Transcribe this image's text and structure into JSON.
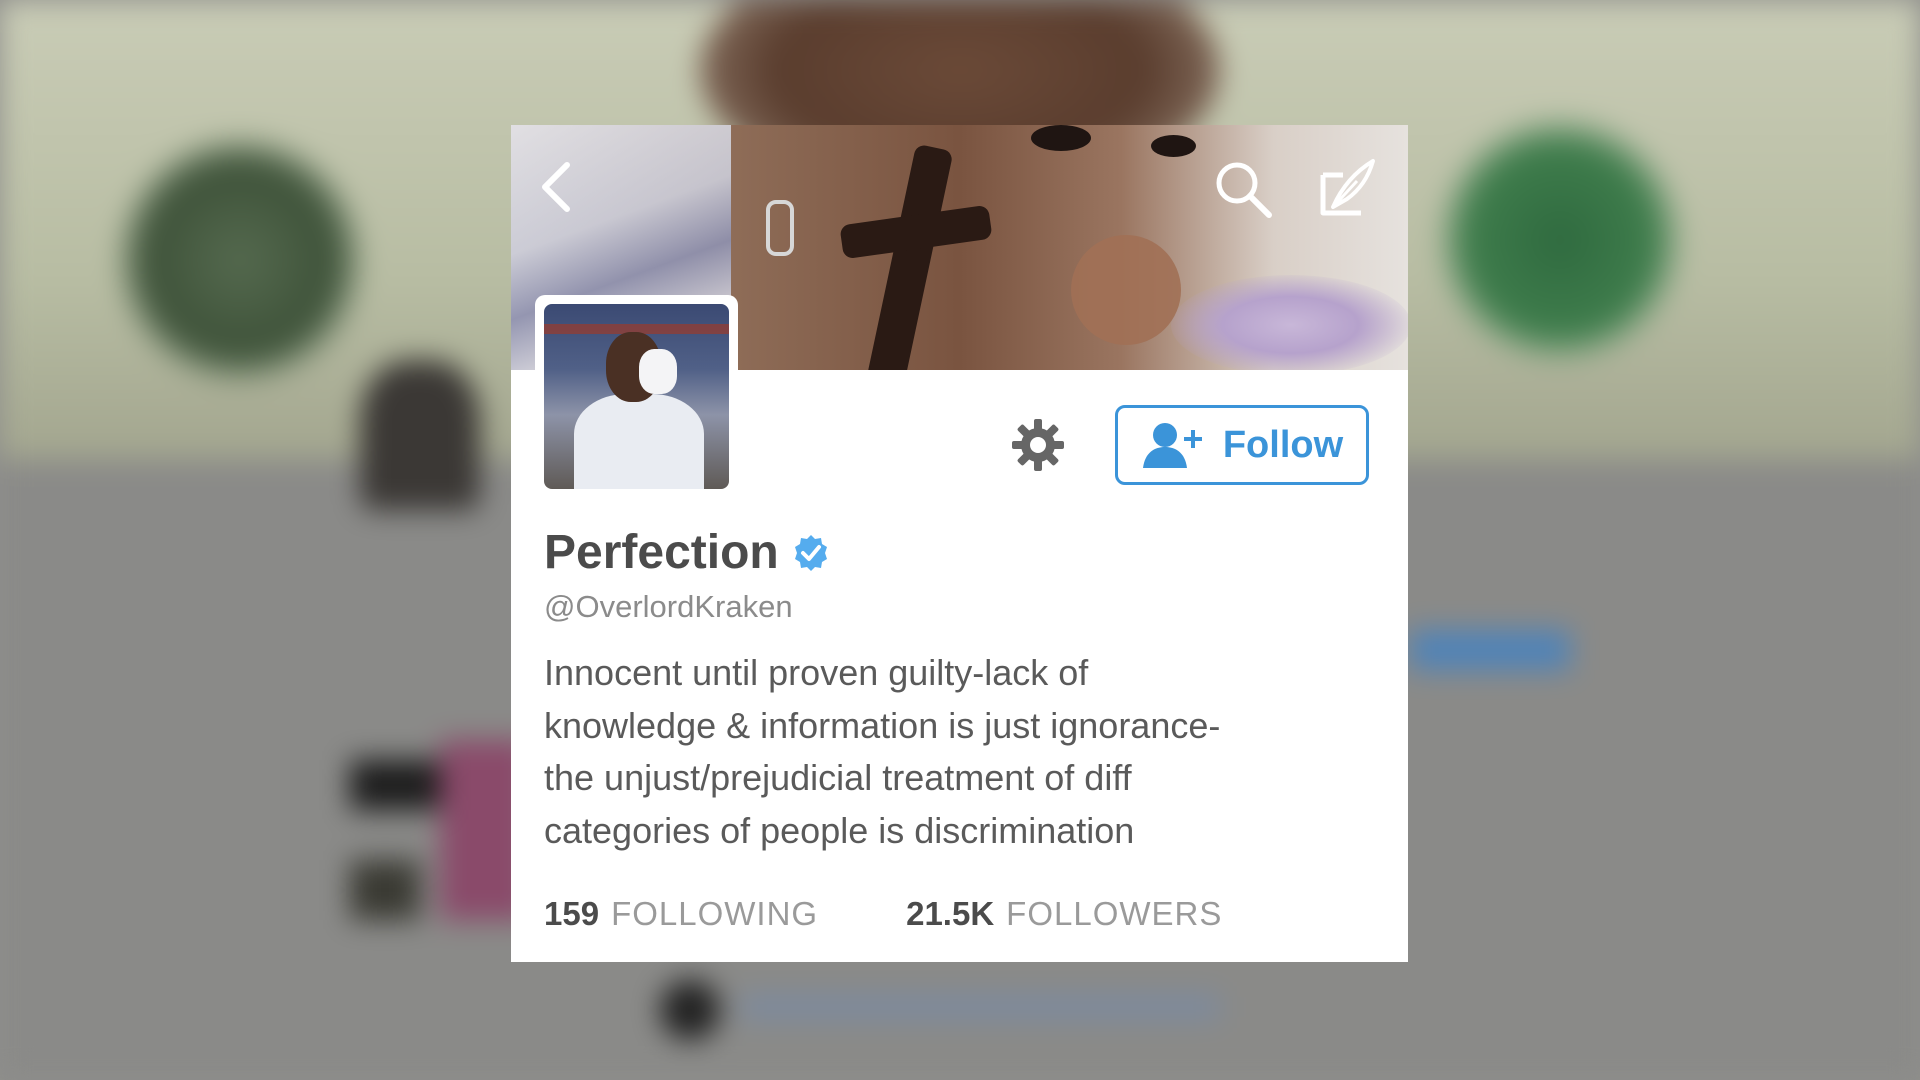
{
  "profile": {
    "display_name": "Perfection",
    "handle": "@OverlordKraken",
    "verified": true,
    "bio_lines": [
      "Innocent until proven guilty-lack of",
      "knowledge & information is just ignorance-",
      "the unjust/prejudicial treatment of diff",
      "categories of people is discrimination"
    ]
  },
  "actions": {
    "follow_label": "Follow"
  },
  "stats": {
    "following_count": "159",
    "following_label": "FOLLOWING",
    "followers_count": "21.5K",
    "followers_label": "FOLLOWERS"
  },
  "icons": {
    "back": "chevron-left-icon",
    "search": "search-icon",
    "compose": "compose-tweet-icon",
    "settings": "gear-icon",
    "follow": "add-user-icon",
    "verified": "verified-badge-icon"
  },
  "colors": {
    "accent": "#3b94d9",
    "verified": "#55acee",
    "text_primary": "#4b4b4b",
    "text_secondary": "#8b8b8b"
  }
}
